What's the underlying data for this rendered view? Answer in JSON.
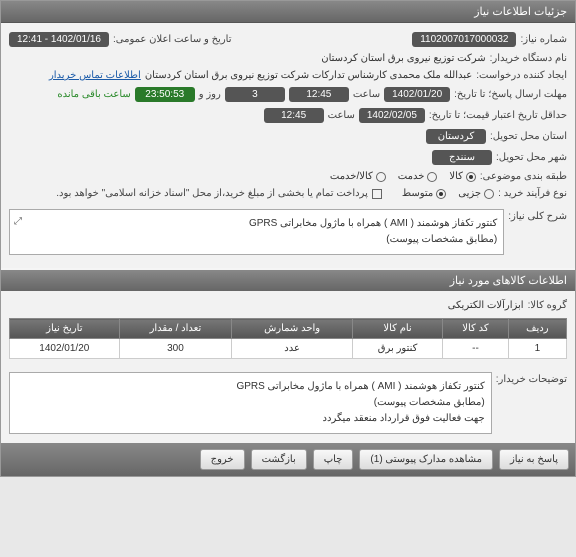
{
  "header": {
    "title": "جزئیات اطلاعات نیاز"
  },
  "fields": {
    "need_no_lbl": "شماره نیاز:",
    "need_no": "1102007017000032",
    "announce_lbl": "تاریخ و ساعت اعلان عمومی:",
    "announce": "1402/01/16 - 12:41",
    "buyer_lbl": "نام دستگاه خریدار:",
    "buyer": "شرکت توزیع نیروی برق استان کردستان",
    "creator_lbl": "ایجاد کننده درخواست:",
    "creator": "عبدالله ملک محمدی کارشناس تدارکات شرکت توزیع نیروی برق استان کردستان",
    "contact_link": "اطلاعات تماس خریدار",
    "deadline_lbl": "حداقل تاریخ اعتبار قیمت؛ تا تاریخ:",
    "deadline_date": "1402/01/20",
    "deadline_time_lbl": "ساعت",
    "deadline_time": "12:45",
    "days": "3",
    "days_lbl": "روز و",
    "remaining": "23:50:53",
    "remaining_lbl": "ساعت باقی مانده",
    "deadline2_lbl": "مهلت ارسال پاسخ؛ تا تاریخ:",
    "deadline2_date": "1402/02/05",
    "deadline2_time": "12:45",
    "province_lbl": "استان محل تحویل:",
    "province": "کردستان",
    "city_lbl": "شهر محل تحویل:",
    "city": "سنندج",
    "category_lbl": "طبقه بندی موضوعی:",
    "cat_goods": "کالا",
    "cat_service": "خدمت",
    "cat_both": "کالا/خدمت",
    "process_lbl": "نوع فرآیند خرید :",
    "proc_minor": "جزیی",
    "proc_medium": "متوسط",
    "pay_note": "پرداخت تمام یا بخشی از مبلغ خرید،از محل \"اسناد خزانه اسلامی\" خواهد بود.",
    "title_lbl": "شرح کلی نیاز:",
    "title_text": "کنتور تکفاز هوشمند ( AMI ) همراه با ماژول مخابراتی GPRS\n(مطابق مشخصات پیوست)",
    "group_lbl": "گروه کالا:",
    "group": "ابزارآلات الکتریکی",
    "desc_lbl": "توضیحات خریدار:",
    "desc_text": "کنتور تکفاز هوشمند ( AMI ) همراه با ماژول مخابراتی GPRS\n(مطابق مشخصات پیوست)\nجهت فعالیت فوق قرارداد منعقد میگردد"
  },
  "section2": {
    "title": "اطلاعات کالاهای مورد نیاز"
  },
  "table": {
    "headers": [
      "ردیف",
      "کد کالا",
      "نام کالا",
      "واحد شمارش",
      "تعداد / مقدار",
      "تاریخ نیاز"
    ],
    "rows": [
      {
        "idx": "1",
        "code": "--",
        "name": "کنتور برق",
        "unit": "عدد",
        "qty": "300",
        "date": "1402/01/20"
      }
    ]
  },
  "buttons": {
    "respond": "پاسخ به نیاز",
    "attachments": "مشاهده مدارک پیوستی (1)",
    "print": "چاپ",
    "back": "بازگشت",
    "exit": "خروج"
  }
}
